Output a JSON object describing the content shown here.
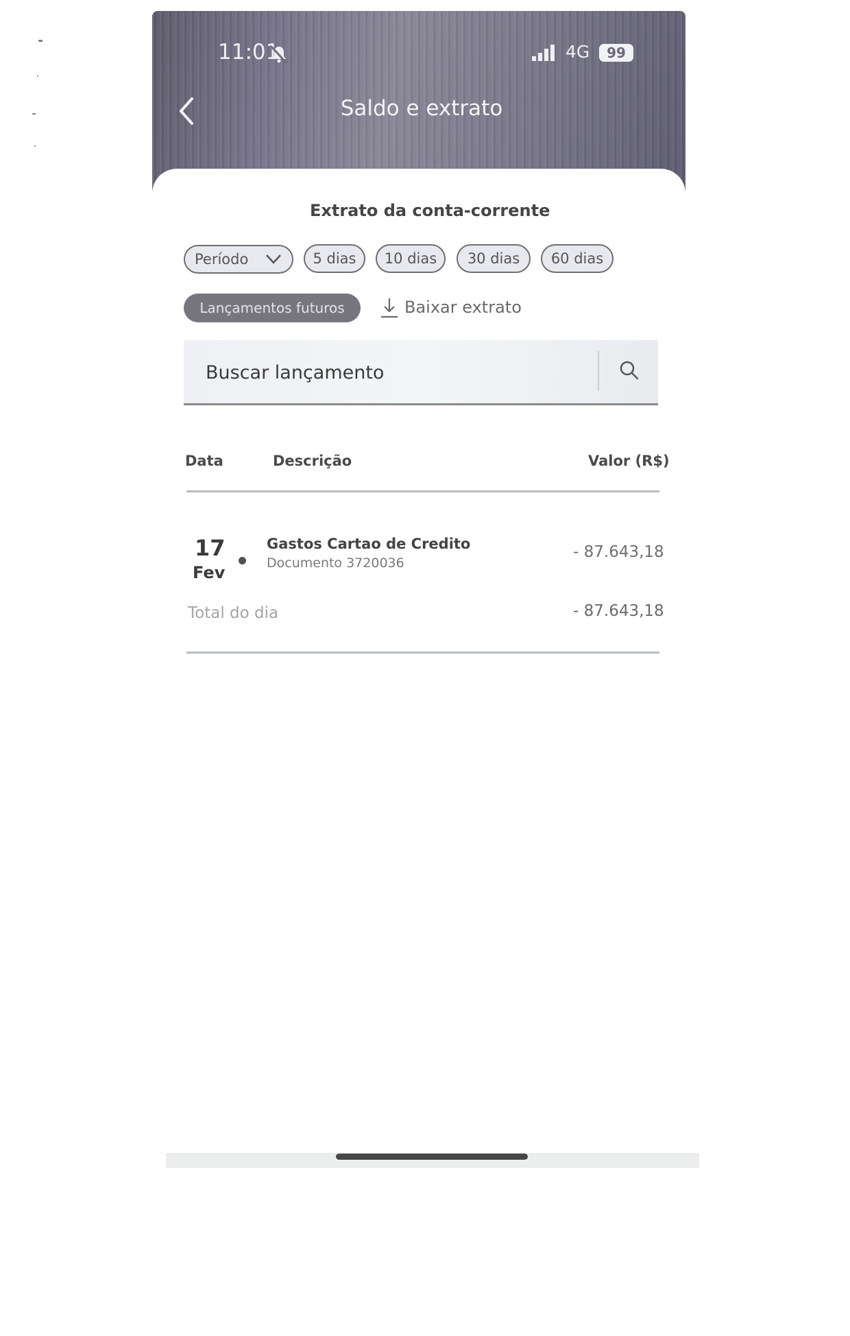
{
  "status_bar": {
    "time": "11:01",
    "network": "4G",
    "battery": "99",
    "icons": [
      "bell-muted-icon",
      "signal-icon"
    ]
  },
  "header": {
    "title": "Saldo e extrato",
    "back_icon": "chevron-left-icon"
  },
  "statement": {
    "title": "Extrato da conta-corrente",
    "filters": {
      "period_label": "Período",
      "period_icon": "chevron-down-icon",
      "chips": [
        "5 dias",
        "10 dias",
        "30 dias",
        "60 dias"
      ]
    },
    "future_label": "Lançamentos futuros",
    "download_label": "Baixar extrato",
    "search": {
      "placeholder": "Buscar lançamento",
      "icon": "search-icon"
    },
    "columns": {
      "date": "Data",
      "description": "Descrição",
      "value": "Valor (R$)"
    },
    "transactions": [
      {
        "day": "17",
        "month": "Fev",
        "description": "Gastos Cartao de Credito",
        "document": "Documento 3720036",
        "value": "- 87.643,18"
      }
    ],
    "daily_total": {
      "label": "Total do dia",
      "value": "- 87.643,18"
    }
  },
  "colors": {
    "header_bg": "#77748a",
    "future_chip_bg": "#77767f",
    "text_primary": "#3a3a3a"
  }
}
